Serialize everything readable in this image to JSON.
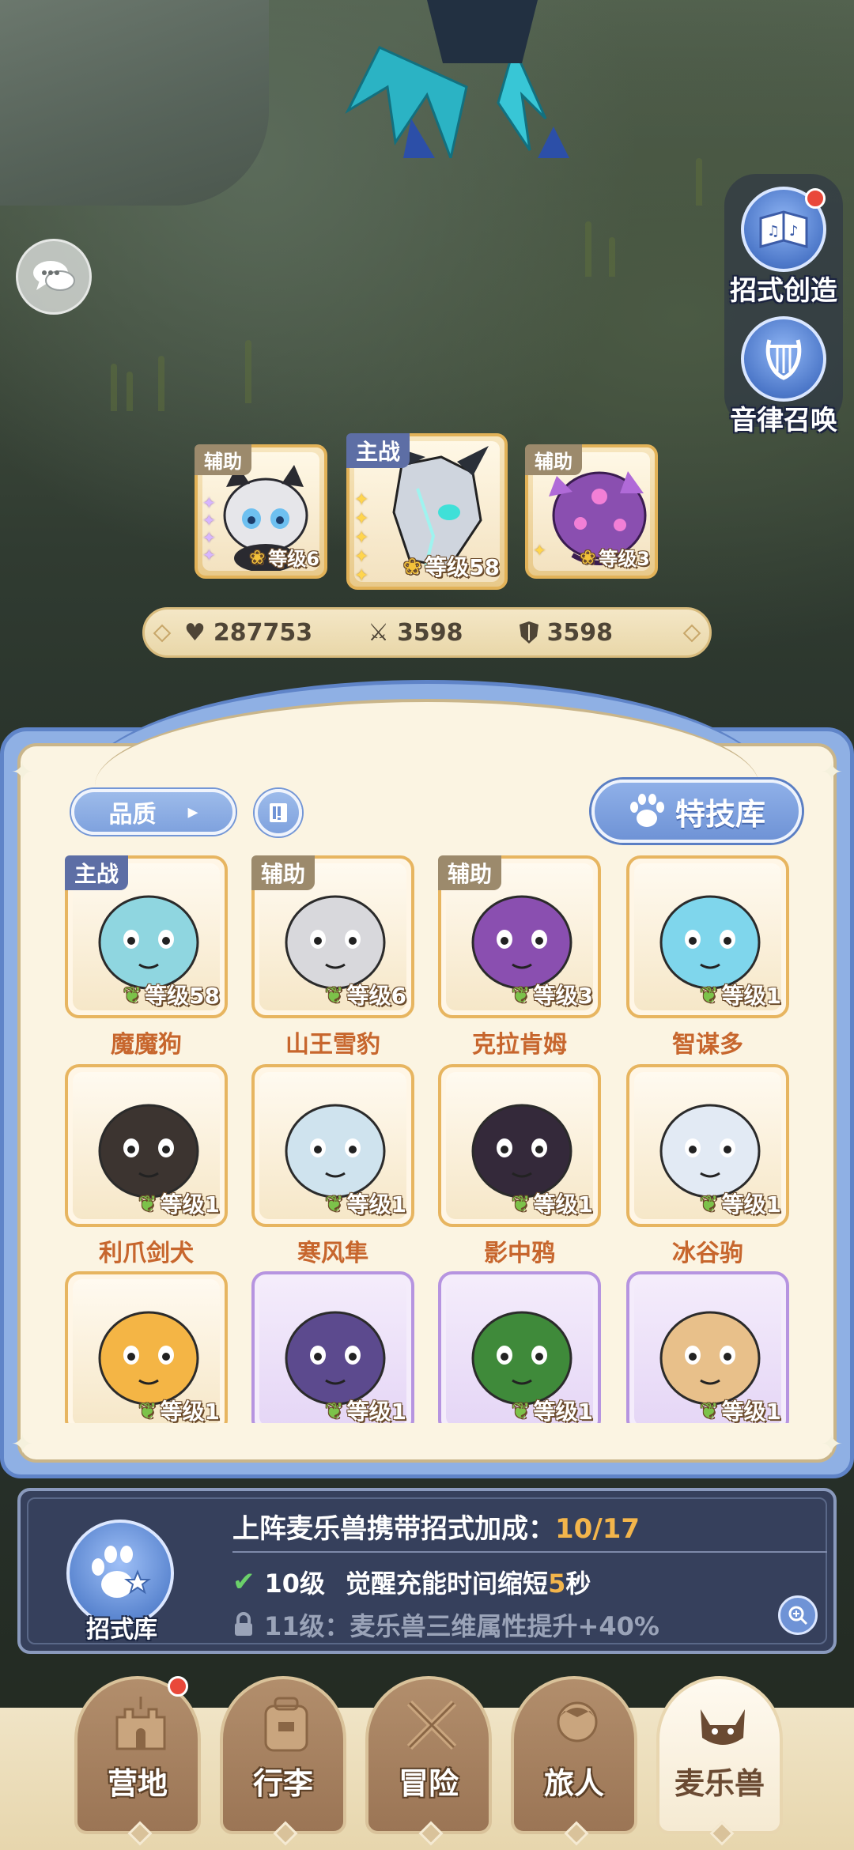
{
  "side_menu": {
    "items": [
      {
        "label": "招式创造",
        "icon": "music-book-icon",
        "has_dot": true
      },
      {
        "label": "音律召唤",
        "icon": "lyre-icon",
        "has_dot": false
      }
    ]
  },
  "team": {
    "left": {
      "role": "辅助",
      "level": "等级6",
      "stars": 4,
      "star_color": "purple"
    },
    "center": {
      "role": "主战",
      "level": "等级58",
      "stars": 5,
      "star_color": "gold"
    },
    "right": {
      "role": "辅助",
      "level": "等级3",
      "stars": 1,
      "star_color": "gold"
    }
  },
  "stats": {
    "hp": "287753",
    "attack": "3598",
    "defense": "3598"
  },
  "filters": {
    "quality_label": "品质",
    "skill_library_label": "特技库"
  },
  "pets": [
    {
      "name": "魔魔狗",
      "level": "等级58",
      "role": "主战",
      "frame": "gold",
      "color": "#8fd6e0"
    },
    {
      "name": "山王雪豹",
      "level": "等级6",
      "role": "辅助",
      "frame": "gold",
      "color": "#d8d8dc"
    },
    {
      "name": "克拉肯姆",
      "level": "等级3",
      "role": "辅助",
      "frame": "gold",
      "color": "#8a4fb0"
    },
    {
      "name": "智谋多",
      "level": "等级1",
      "role": "",
      "frame": "gold",
      "color": "#7fd6ec"
    },
    {
      "name": "利爪剑犬",
      "level": "等级1",
      "role": "",
      "frame": "gold",
      "color": "#3c3430"
    },
    {
      "name": "寒风隼",
      "level": "等级1",
      "role": "",
      "frame": "gold",
      "color": "#cfe3ee"
    },
    {
      "name": "影中鸦",
      "level": "等级1",
      "role": "",
      "frame": "gold",
      "color": "#34293a"
    },
    {
      "name": "冰谷驹",
      "level": "等级1",
      "role": "",
      "frame": "gold",
      "color": "#e2eaf4"
    },
    {
      "name": "",
      "level": "等级1",
      "role": "",
      "frame": "gold",
      "color": "#f4b545"
    },
    {
      "name": "",
      "level": "等级1",
      "role": "",
      "frame": "purple",
      "color": "#5c4a8e"
    },
    {
      "name": "",
      "level": "等级1",
      "role": "",
      "frame": "purple",
      "color": "#3f8a3a"
    },
    {
      "name": "",
      "level": "等级1",
      "role": "",
      "frame": "purple",
      "color": "#e8c08a"
    }
  ],
  "bonus": {
    "title": "上阵麦乐兽携带招式加成：",
    "progress": "10/17",
    "icon_label": "招式库",
    "done_level": "10级",
    "done_text_before": "觉醒充能时间缩短",
    "done_value": "5",
    "done_text_after": "秒",
    "locked_text": "11级：麦乐兽三维属性提升+40%"
  },
  "nav": [
    {
      "label": "营地",
      "icon": "castle-icon",
      "active": false,
      "has_dot": true
    },
    {
      "label": "行李",
      "icon": "backpack-icon",
      "active": false,
      "has_dot": false
    },
    {
      "label": "冒险",
      "icon": "crossed-swords-icon",
      "active": false,
      "has_dot": false
    },
    {
      "label": "旅人",
      "icon": "traveler-icon",
      "active": false,
      "has_dot": false
    },
    {
      "label": "麦乐兽",
      "icon": "cat-pet-icon",
      "active": true,
      "has_dot": false
    }
  ],
  "colors": {
    "panel_blue": "#8fb0e4",
    "panel_cream": "#fbf4e2",
    "name_orange": "#c7662d",
    "gold_frame": "#e7b560",
    "purple_frame": "#b694e0",
    "highlight": "#f3b54b"
  }
}
